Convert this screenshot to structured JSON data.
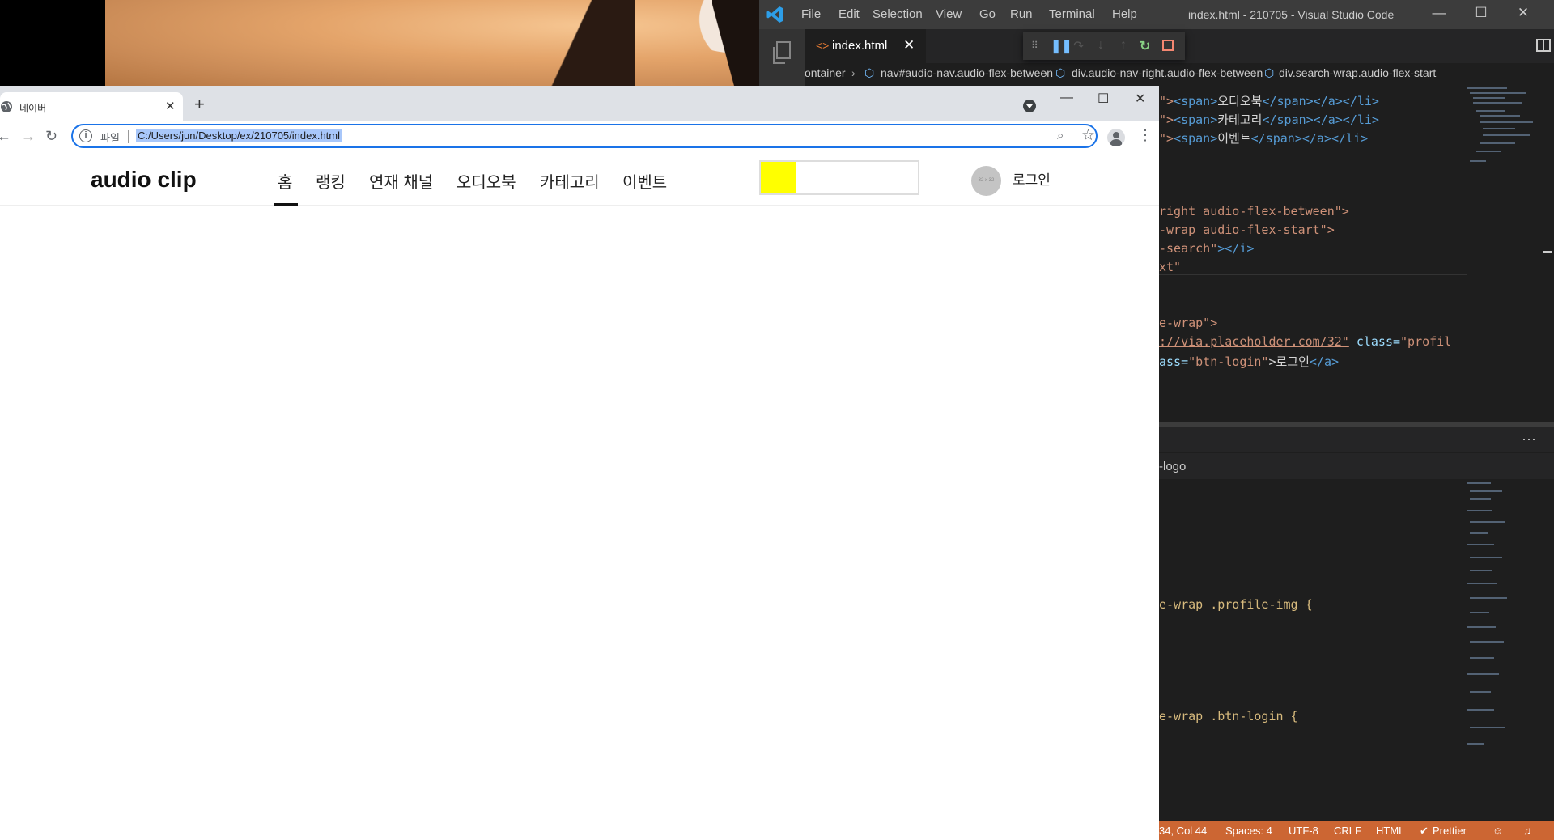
{
  "vscode": {
    "menu": [
      "File",
      "Edit",
      "Selection",
      "View",
      "Go",
      "Run",
      "Terminal",
      "Help"
    ],
    "title": "index.html - 210705 - Visual Studio Code",
    "tab_label": "index.html",
    "breadcrumb": [
      "ontainer",
      "nav#audio-nav.audio-flex-between",
      "div.audio-nav-right.audio-flex-between",
      "div.search-wrap.audio-flex-start"
    ],
    "code_top": [
      {
        "a": "\">",
        "b": "<span>",
        "c": "오디오북",
        "d": "</span></a></li>"
      },
      {
        "a": "\">",
        "b": "<span>",
        "c": "카테고리",
        "d": "</span></a></li>"
      },
      {
        "a": "\">",
        "b": "<span>",
        "c": "이벤트",
        "d": "</span></a></li>"
      }
    ],
    "code_mid": {
      "line1": "right audio-flex-between\">",
      "line2": "-wrap audio-flex-start\">",
      "line3a": "-search\"",
      "line3b": "></i>",
      "line4": "xt\"",
      "line5": "e-wrap\">",
      "line6a": "://via.placeholder.com/32\"",
      "line6b": " class=",
      "line6c": "\"profil",
      "line7a": "ass=",
      "line7b": "\"btn-login\"",
      "line7c": ">로그인",
      "line7d": "</a>"
    },
    "outline_label": "-logo",
    "code_bottom": [
      "e-wrap .profile-img {",
      "e-wrap .btn-login {"
    ],
    "status": {
      "position": "34, Col 44",
      "spaces": "Spaces: 4",
      "encoding": "UTF-8",
      "eol": "CRLF",
      "language": "HTML",
      "prettier": "Prettier"
    }
  },
  "chrome": {
    "tab_title": "네이버",
    "scheme_label": "파일",
    "url": "C:/Users/jun/Desktop/ex/210705/index.html"
  },
  "site": {
    "logo": "audio clip",
    "nav": [
      "홈",
      "랭킹",
      "연재 채널",
      "오디오북",
      "카테고리",
      "이벤트"
    ],
    "active_nav": "홈",
    "profile_placeholder": "32 x 32",
    "login_label": "로그인",
    "search_color": "#ffff00"
  },
  "colors": {
    "vscode_status": "#cc6633",
    "chrome_focus": "#1a73e8"
  }
}
